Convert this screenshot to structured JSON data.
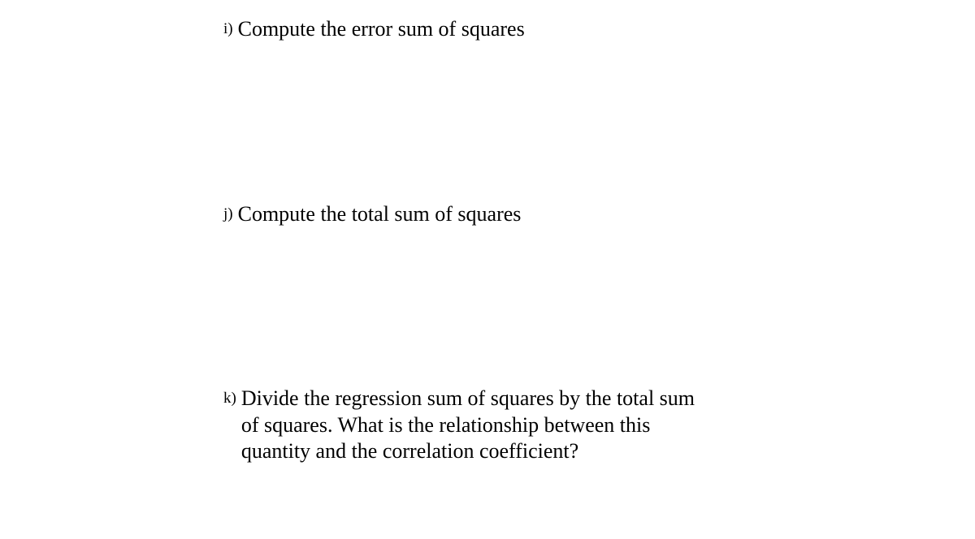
{
  "items": {
    "i": {
      "label": "i)",
      "text": "Compute the error sum of squares"
    },
    "j": {
      "label": "j)",
      "text": "Compute the total sum of squares"
    },
    "k": {
      "label": "k)",
      "text": "Divide the regression sum of squares by the total sum of squares. What is the relationship between this quantity and the correlation coefficient?"
    }
  }
}
